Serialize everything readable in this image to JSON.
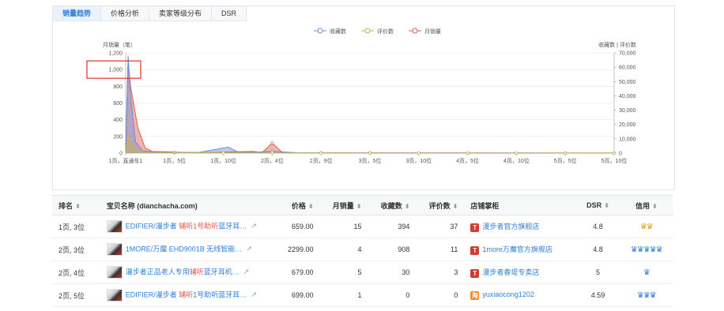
{
  "tabs": [
    "销量趋势",
    "价格分析",
    "卖家等级分布",
    "DSR"
  ],
  "active_tab": 0,
  "legend": [
    {
      "name": "收藏数",
      "color": "#6a8fd6"
    },
    {
      "name": "评价数",
      "color": "#c9b24a"
    },
    {
      "name": "月销量",
      "color": "#e05a4d"
    }
  ],
  "chart": {
    "left_axis_title": "月销量（笔）",
    "right_axis_title": "收藏数 | 评价数",
    "left_ticks": [
      "0",
      "200",
      "400",
      "600",
      "800",
      "1,000",
      "1,200"
    ],
    "right_ticks": [
      "0",
      "10,000",
      "20,000",
      "30,000",
      "40,000",
      "50,000",
      "60,000",
      "70,000"
    ],
    "x_ticks": [
      "1页，直通车1",
      "1页，5位",
      "1页，10位",
      "2页，4位",
      "2页，9位",
      "3页，5位",
      "3页，10位",
      "4页，5位",
      "4页，10位",
      "5页，5位",
      "5页，10位"
    ]
  },
  "chart_data": {
    "type": "area",
    "x_range": [
      0,
      10
    ],
    "ylim_left": [
      0,
      1200
    ],
    "ylim_right": [
      0,
      70000
    ],
    "series": [
      {
        "name": "月销量",
        "axis": "left",
        "color": "#e05a4d",
        "points": [
          [
            0,
            0
          ],
          [
            0.05,
            1100
          ],
          [
            0.1,
            800
          ],
          [
            0.25,
            300
          ],
          [
            0.4,
            60
          ],
          [
            0.55,
            20
          ],
          [
            0.9,
            15
          ],
          [
            1.2,
            8
          ],
          [
            1.6,
            5
          ],
          [
            2.2,
            15
          ],
          [
            2.6,
            20
          ],
          [
            2.8,
            10
          ],
          [
            3.0,
            120
          ],
          [
            3.2,
            10
          ],
          [
            3.5,
            5
          ],
          [
            4,
            3
          ],
          [
            5,
            3
          ],
          [
            6,
            2
          ],
          [
            7,
            2
          ],
          [
            8,
            1
          ],
          [
            9,
            1
          ],
          [
            10,
            1
          ]
        ]
      },
      {
        "name": "收藏数",
        "axis": "right",
        "color": "#6a8fd6",
        "points": [
          [
            0,
            0
          ],
          [
            0.05,
            68000
          ],
          [
            0.1,
            40000
          ],
          [
            0.2,
            8000
          ],
          [
            0.35,
            1500
          ],
          [
            0.6,
            800
          ],
          [
            1.0,
            600
          ],
          [
            1.5,
            500
          ],
          [
            1.9,
            3000
          ],
          [
            2.1,
            4200
          ],
          [
            2.3,
            900
          ],
          [
            2.6,
            600
          ],
          [
            3.0,
            1200
          ],
          [
            3.5,
            300
          ],
          [
            4,
            200
          ],
          [
            5,
            150
          ],
          [
            6,
            120
          ],
          [
            7,
            100
          ],
          [
            8,
            90
          ],
          [
            9,
            80
          ],
          [
            10,
            80
          ]
        ]
      },
      {
        "name": "评价数",
        "axis": "right",
        "color": "#c9b24a",
        "points": [
          [
            0,
            0
          ],
          [
            0.05,
            12000
          ],
          [
            0.1,
            8000
          ],
          [
            0.2,
            2000
          ],
          [
            0.4,
            600
          ],
          [
            0.8,
            300
          ],
          [
            1.5,
            200
          ],
          [
            2,
            200
          ],
          [
            3,
            150
          ],
          [
            4,
            100
          ],
          [
            5,
            80
          ],
          [
            6,
            60
          ],
          [
            7,
            50
          ],
          [
            8,
            40
          ],
          [
            9,
            30
          ],
          [
            10,
            30
          ]
        ]
      }
    ]
  },
  "table": {
    "headers": [
      "排名",
      "宝贝名称 (dianchacha.com)",
      "价格",
      "月销量",
      "收藏数",
      "评价数",
      "店铺掌柜",
      "DSR",
      "信用"
    ],
    "sort_icon": "⬍",
    "ext_icon": "↗",
    "rows": [
      {
        "rank": "1页, 3位",
        "title_prefix": "EDIFIER/漫步者 ",
        "title_hl": "辅听1号助听",
        "title_suffix": "蓝牙耳…",
        "price": "659.00",
        "sales": "15",
        "fav": "394",
        "reviews": "37",
        "shop_badge": "T",
        "shop": "漫步者官方旗舰店",
        "dsr": "4.8",
        "credit": "♛♛",
        "credit_color": "gold"
      },
      {
        "rank": "2页, 3位",
        "title_prefix": "1MORE/万魔 EHD9001B 无线智能…",
        "title_hl": "",
        "title_suffix": "",
        "price": "2299.00",
        "sales": "4",
        "fav": "908",
        "reviews": "11",
        "shop_badge": "T",
        "shop": "1more万魔官方旗舰店",
        "dsr": "4.8",
        "credit": "♛♛♛♛♛",
        "credit_color": "blue"
      },
      {
        "rank": "2页, 4位",
        "title_prefix": "漫步者正品老人专用",
        "title_hl": "辅听",
        "title_suffix": "蓝牙耳机…",
        "price": "679.00",
        "sales": "5",
        "fav": "30",
        "reviews": "3",
        "shop_badge": "T",
        "shop": "漫步者春堤专卖店",
        "dsr": "5",
        "credit": "♛",
        "credit_color": "blue"
      },
      {
        "rank": "2页, 5位",
        "title_prefix": "EDIFIER/漫步者 ",
        "title_hl": "辅听",
        "title_suffix": "1号助听蓝牙耳…",
        "price": "699.00",
        "sales": "1",
        "fav": "0",
        "reviews": "0",
        "shop_badge": "淘",
        "shop": "yuxiaocong1202",
        "dsr": "4.59",
        "credit": "♛♛♛",
        "credit_color": "blue"
      }
    ]
  }
}
